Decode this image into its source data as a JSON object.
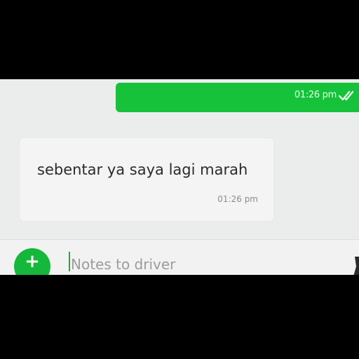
{
  "colors": {
    "accent": "#16c23a",
    "outgoing_bubble": "#16c23a",
    "incoming_bubble": "#f3f4f3",
    "background": "#ebedec"
  },
  "chat": {
    "outgoing": {
      "time": "01:26 pm",
      "status_icon": "double-check-icon"
    },
    "incoming": {
      "text": "sebentar ya saya lagi marah",
      "time": "01:26 pm"
    }
  },
  "composer": {
    "add_icon": "plus-icon",
    "placeholder": "Notes to driver",
    "value": ""
  }
}
